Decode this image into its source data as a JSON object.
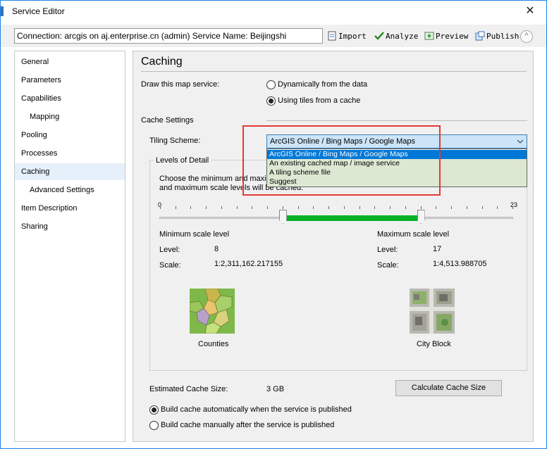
{
  "window": {
    "title": "Service Editor",
    "close_glyph": "✕"
  },
  "toolbar": {
    "connection_text": "Connection: arcgis on aj.enterprise.cn (admin)   Service Name: Beijingshi",
    "import_label": "Import",
    "analyze_label": "Analyze",
    "preview_label": "Preview",
    "publish_label": "Publish",
    "collapse_glyph": "^"
  },
  "sidebar": {
    "items": [
      {
        "label": "General"
      },
      {
        "label": "Parameters"
      },
      {
        "label": "Capabilities"
      },
      {
        "label": "Mapping"
      },
      {
        "label": "Pooling"
      },
      {
        "label": "Processes"
      },
      {
        "label": "Caching"
      },
      {
        "label": "Advanced Settings"
      },
      {
        "label": "Item Description"
      },
      {
        "label": "Sharing"
      }
    ],
    "selected": "Caching"
  },
  "caching": {
    "title": "Caching",
    "draw_label": "Draw this map service:",
    "draw_options": [
      "Dynamically from the data",
      "Using tiles from a cache"
    ],
    "draw_selected": "Using tiles from a cache",
    "cache_settings_label": "Cache Settings",
    "tiling_scheme_label": "Tiling Scheme:",
    "tiling_scheme_value": "ArcGIS Online / Bing Maps / Google Maps",
    "tiling_scheme_options": [
      "ArcGIS Online / Bing Maps / Google Maps",
      "An existing cached map / image service",
      "A tiling scheme file",
      "Suggest"
    ],
    "levels_of_detail_label": "Levels of Detail",
    "levels_desc_line1": "Choose the minimum and maxim",
    "levels_desc_line2": "and maximum scale levels will be cached.",
    "slider": {
      "min_label": "0",
      "max_label": "23",
      "min": 0,
      "max": 23,
      "low": 8,
      "high": 17
    },
    "minimum_scale": {
      "heading": "Minimum scale level",
      "level_label": "Level:",
      "level_value": "8",
      "scale_label": "Scale:",
      "scale_value": "1:2,311,162.217155",
      "thumb_caption": "Counties"
    },
    "maximum_scale": {
      "heading": "Maximum scale level",
      "level_label": "Level:",
      "level_value": "17",
      "scale_label": "Scale:",
      "scale_value": "1:4,513.988705",
      "thumb_caption": "City Block"
    },
    "estimated_cache_label": "Estimated Cache Size:",
    "estimated_cache_value": "3 GB",
    "calc_button_label": "Calculate Cache Size",
    "build_options": [
      "Build cache automatically when the service is published",
      "Build cache manually after the service is published"
    ],
    "build_selected": "Build cache automatically when the service is published"
  },
  "colors": {
    "accent": "#0078d7",
    "fill": "#06b025",
    "highlight": "#e53935"
  }
}
